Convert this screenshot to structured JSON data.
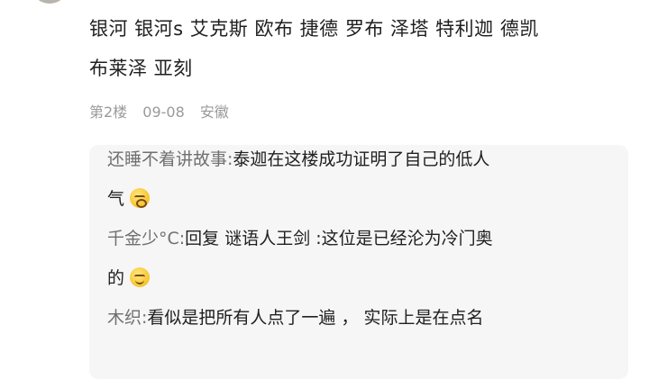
{
  "post": {
    "lines": [
      "银河 银河s 艾克斯 欧布 捷德 罗布 泽塔 特利迦 德凯",
      "布莱泽 亚刻"
    ]
  },
  "meta": {
    "floor": "第2楼",
    "date": "09-08",
    "location": "安徽"
  },
  "replies": [
    {
      "author": "还睡不着讲故事:",
      "line1": "泰迦在这楼成功证明了自己的低人",
      "line2": "气",
      "emoji": "blush-face-icon"
    },
    {
      "author": "千金少°C:",
      "line1": "回复 谜语人王剑 :这位是已经沦为冷门奥",
      "line2": "的",
      "emoji": "smile-face-icon"
    },
    {
      "author": "木织:",
      "line1": "看似是把所有人点了一遍 ， 实际上是在点名"
    }
  ]
}
